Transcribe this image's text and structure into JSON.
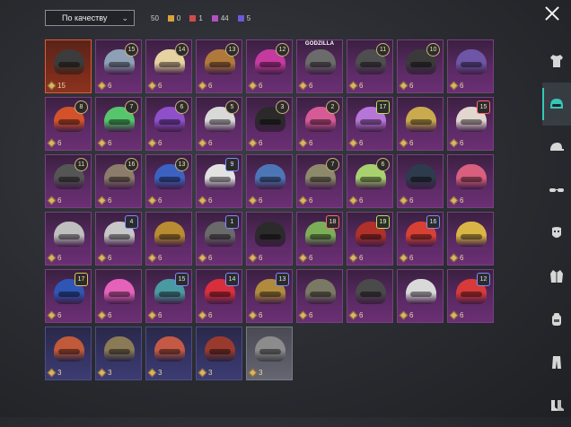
{
  "header": {
    "sort_label": "По качеству",
    "total": "50",
    "counts": [
      {
        "value": "0",
        "color": "#d9a33b"
      },
      {
        "value": "1",
        "color": "#d24b4b"
      },
      {
        "value": "44",
        "color": "#b44fc4"
      },
      {
        "value": "5",
        "color": "#6a5bd6"
      }
    ]
  },
  "icons": {
    "close": "close-icon",
    "dropdown": "chevron-down-icon",
    "coin": "coin-icon"
  },
  "inventory": {
    "rows": [
      [
        {
          "qty": "15",
          "level": "",
          "style": "orange",
          "selected": true,
          "color": "#3c3c3c"
        },
        {
          "qty": "6",
          "level": "15",
          "style": "",
          "color": "#8ea0b5"
        },
        {
          "qty": "6",
          "level": "14",
          "style": "",
          "color": "#e6d3a1"
        },
        {
          "qty": "6",
          "level": "13",
          "style": "",
          "color": "#b0793c"
        },
        {
          "qty": "6",
          "level": "12",
          "style": "",
          "color": "#c53a9f"
        },
        {
          "qty": "6",
          "level": "",
          "style": "",
          "color": "#6b6b6b",
          "badge": "GODZILLA"
        },
        {
          "qty": "6",
          "level": "11",
          "style": "",
          "color": "#4e4e4e"
        },
        {
          "qty": "6",
          "level": "10",
          "style": "",
          "color": "#3a3a3a"
        },
        {
          "qty": "6",
          "level": "",
          "style": "",
          "color": "#6d56a5"
        }
      ],
      [
        {
          "qty": "6",
          "level": "8",
          "style": "",
          "color": "#d3522b"
        },
        {
          "qty": "6",
          "level": "7",
          "style": "",
          "color": "#55c66b"
        },
        {
          "qty": "6",
          "level": "6",
          "style": "",
          "color": "#8e4fc9"
        },
        {
          "qty": "6",
          "level": "5",
          "style": "",
          "color": "#d9d9d9"
        },
        {
          "qty": "6",
          "level": "3",
          "style": "",
          "color": "#2a2a2a"
        },
        {
          "qty": "6",
          "level": "2",
          "style": "",
          "color": "#d65a95"
        },
        {
          "qty": "6",
          "level": "17",
          "style": "",
          "color": "#b776d7",
          "lvl_style": "green"
        },
        {
          "qty": "6",
          "level": "",
          "style": "",
          "color": "#c9aa4e"
        },
        {
          "qty": "6",
          "level": "15",
          "style": "",
          "color": "#e2d6d0",
          "lvl_style": "red"
        }
      ],
      [
        {
          "qty": "6",
          "level": "11",
          "style": "",
          "color": "#555555"
        },
        {
          "qty": "6",
          "level": "16",
          "style": "",
          "color": "#8b7c6b"
        },
        {
          "qty": "6",
          "level": "13",
          "style": "",
          "color": "#3c62c1"
        },
        {
          "qty": "6",
          "level": "9",
          "style": "",
          "color": "#e2e2e2",
          "lvl_style": "blue"
        },
        {
          "qty": "6",
          "level": "",
          "style": "",
          "color": "#4d76b7"
        },
        {
          "qty": "6",
          "level": "7",
          "style": "",
          "color": "#8c8a6b"
        },
        {
          "qty": "6",
          "level": "6",
          "style": "",
          "color": "#a8d26f"
        },
        {
          "qty": "6",
          "level": "",
          "style": "",
          "color": "#2e3b4c"
        },
        {
          "qty": "6",
          "level": "",
          "style": "",
          "color": "#d85f7d"
        }
      ],
      [
        {
          "qty": "6",
          "level": "",
          "style": "",
          "color": "#bfbfbf"
        },
        {
          "qty": "6",
          "level": "4",
          "style": "",
          "color": "#c7c7c7",
          "lvl_style": "blue"
        },
        {
          "qty": "6",
          "level": "",
          "style": "",
          "color": "#b98b32"
        },
        {
          "qty": "6",
          "level": "1",
          "style": "",
          "color": "#6a6a6a",
          "lvl_style": "blue"
        },
        {
          "qty": "6",
          "level": "",
          "style": "",
          "color": "#2b2b2b"
        },
        {
          "qty": "6",
          "level": "18",
          "style": "",
          "color": "#7cae58",
          "lvl_style": "red"
        },
        {
          "qty": "6",
          "level": "19",
          "style": "",
          "color": "#b0302a",
          "lvl_style": "green"
        },
        {
          "qty": "6",
          "level": "16",
          "style": "",
          "color": "#d94034",
          "lvl_style": "blue"
        },
        {
          "qty": "6",
          "level": "",
          "style": "",
          "color": "#d9b545"
        }
      ],
      [
        {
          "qty": "6",
          "level": "17",
          "style": "",
          "color": "#2f55b5",
          "lvl_style": "gold"
        },
        {
          "qty": "6",
          "level": "",
          "style": "",
          "color": "#e462b9"
        },
        {
          "qty": "6",
          "level": "15",
          "style": "",
          "color": "#4a9aa1",
          "lvl_style": "blue"
        },
        {
          "qty": "6",
          "level": "14",
          "style": "",
          "color": "#d72f3c",
          "lvl_style": "blue"
        },
        {
          "qty": "6",
          "level": "13",
          "style": "",
          "color": "#b08b3d",
          "lvl_style": "blue"
        },
        {
          "qty": "6",
          "level": "",
          "style": "",
          "color": "#7a7a64"
        },
        {
          "qty": "6",
          "level": "",
          "style": "",
          "color": "#4a4a4a"
        },
        {
          "qty": "6",
          "level": "",
          "style": "",
          "color": "#d9d9d9"
        },
        {
          "qty": "6",
          "level": "12",
          "style": "",
          "color": "#d63a3a",
          "lvl_style": "blue"
        }
      ],
      [
        {
          "qty": "3",
          "level": "",
          "style": "blue",
          "color": "#c05a3a"
        },
        {
          "qty": "3",
          "level": "",
          "style": "blue",
          "color": "#8b7a56"
        },
        {
          "qty": "3",
          "level": "",
          "style": "blue",
          "color": "#c45a45"
        },
        {
          "qty": "3",
          "level": "",
          "style": "blue",
          "color": "#9a3a2f"
        },
        {
          "qty": "3",
          "level": "",
          "style": "grey",
          "color": "#8c8c8c"
        }
      ]
    ]
  },
  "sidebar": {
    "items": [
      {
        "name": "sidebar-item-shirt",
        "icon": "shirt-icon",
        "active": false
      },
      {
        "name": "sidebar-item-helmet",
        "icon": "helmet-icon",
        "active": true
      },
      {
        "name": "sidebar-item-cap",
        "icon": "cap-icon",
        "active": false
      },
      {
        "name": "sidebar-item-glasses",
        "icon": "glasses-icon",
        "active": false
      },
      {
        "name": "sidebar-item-mask",
        "icon": "mask-icon",
        "active": false
      },
      {
        "name": "sidebar-item-jacket",
        "icon": "jacket-icon",
        "active": false
      },
      {
        "name": "sidebar-item-backpack",
        "icon": "backpack-icon",
        "active": false
      },
      {
        "name": "sidebar-item-pants",
        "icon": "pants-icon",
        "active": false
      },
      {
        "name": "sidebar-item-shoes",
        "icon": "shoes-icon",
        "active": false
      }
    ]
  }
}
